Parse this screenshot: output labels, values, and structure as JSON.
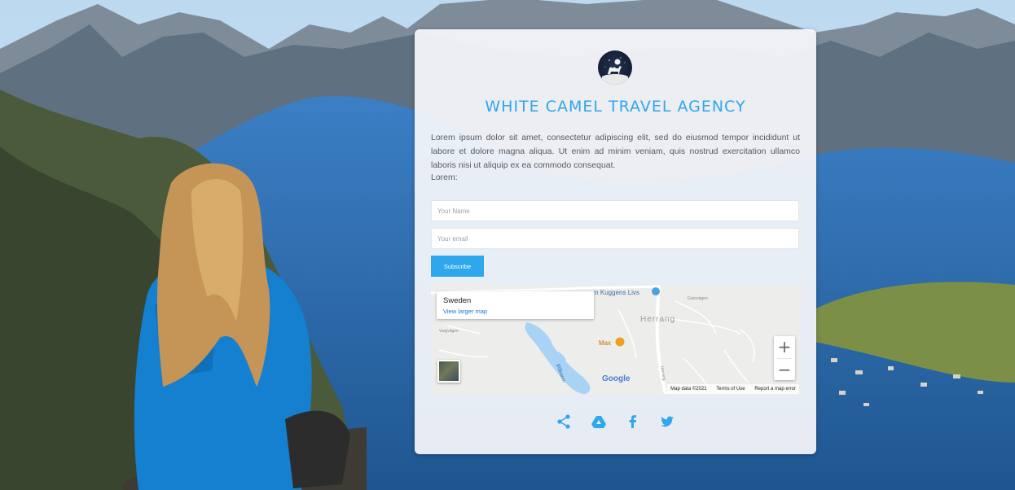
{
  "brand": {
    "title": "WHITE CAMEL TRAVEL AGENCY",
    "logo_icon": "camel-logo-icon"
  },
  "intro": {
    "text": "Lorem ipsum dolor sit amet, consectetur adipiscing elit, sed do eiusmod tempor incididunt ut labore et dolore magna aliqua. Ut enim ad minim veniam, quis nostrud exercitation ullamco laboris nisi ut aliquip ex ea commodo consequat.",
    "extra": "Lorem:"
  },
  "form": {
    "name_placeholder": "Your Name",
    "email_placeholder": "Your email",
    "subscribe_label": "Subscribe"
  },
  "map": {
    "place_name": "Sweden",
    "larger_map_link": "View larger map",
    "poi_kuggens": "m Kuggens Livs",
    "poi_herrang": "Herrang",
    "poi_max": "Max",
    "zoom_in": "+",
    "zoom_out": "−",
    "google_logo": "Google",
    "map_data": "Map data ©2021",
    "terms": "Terms of Use",
    "report": "Report a map error"
  },
  "social": {
    "icons": [
      "share-icon",
      "google-drive-icon",
      "facebook-icon",
      "twitter-icon"
    ]
  },
  "colors": {
    "accent": "#2ea7ec",
    "text": "#555a66",
    "card_bg": "#f6f8fb"
  }
}
